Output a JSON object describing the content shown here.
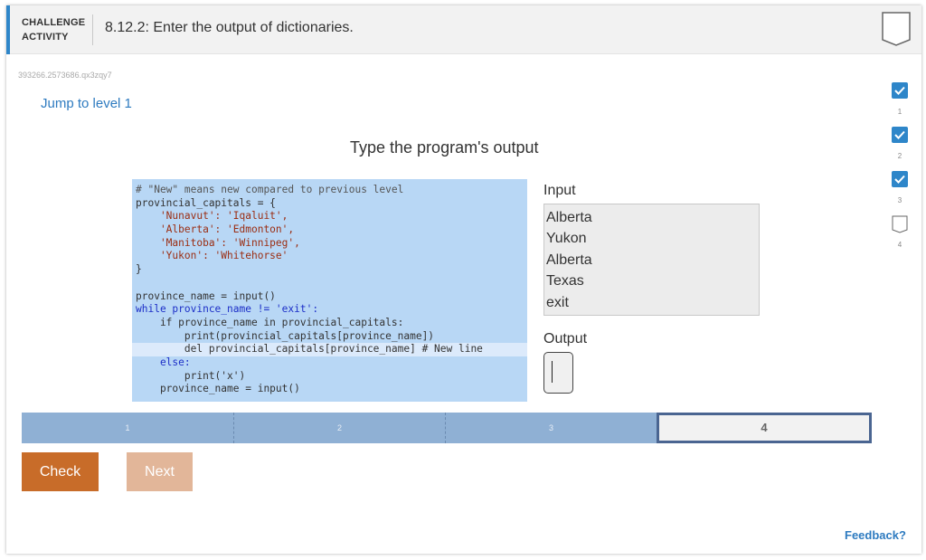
{
  "header": {
    "activity_kind_line1": "CHALLENGE",
    "activity_kind_line2": "ACTIVITY",
    "title": "8.12.2: Enter the output of dictionaries.",
    "accent_color": "#2e86c9"
  },
  "identifier": "393266.2573686.qx3zqy7",
  "jump_link": "Jump to level 1",
  "prompt": "Type the program's output",
  "code_lines": [
    "# \"New\" means new compared to previous level",
    "provincial_capitals = {",
    "    'Nunavut': 'Iqaluit',",
    "    'Alberta': 'Edmonton',",
    "    'Manitoba': 'Winnipeg',",
    "    'Yukon': 'Whitehorse'",
    "}",
    "",
    "province_name = input()",
    "while province_name != 'exit':",
    "    if province_name in provincial_capitals:",
    "        print(provincial_capitals[province_name])",
    "        del provincial_capitals[province_name] # New line",
    "    else:",
    "        print('x')",
    "    province_name = input()"
  ],
  "input_label": "Input",
  "input_lines": [
    "Alberta",
    "Yukon",
    "Alberta",
    "Texas",
    "exit"
  ],
  "output_label": "Output",
  "output_value": "",
  "levels": [
    {
      "num": "1",
      "done": true
    },
    {
      "num": "2",
      "done": true
    },
    {
      "num": "3",
      "done": true
    },
    {
      "num": "4",
      "done": false
    }
  ],
  "progress_segments": [
    "1",
    "2",
    "3",
    "4"
  ],
  "active_segment": "4",
  "buttons": {
    "check": "Check",
    "next": "Next"
  },
  "feedback_link": "Feedback?",
  "colors": {
    "code_bg": "#b8d7f5",
    "check_button": "#c86c29",
    "next_button": "#e2b699",
    "progress_done": "#8fb0d4",
    "progress_active_border": "#4a6591",
    "link": "#2e7bc0"
  }
}
